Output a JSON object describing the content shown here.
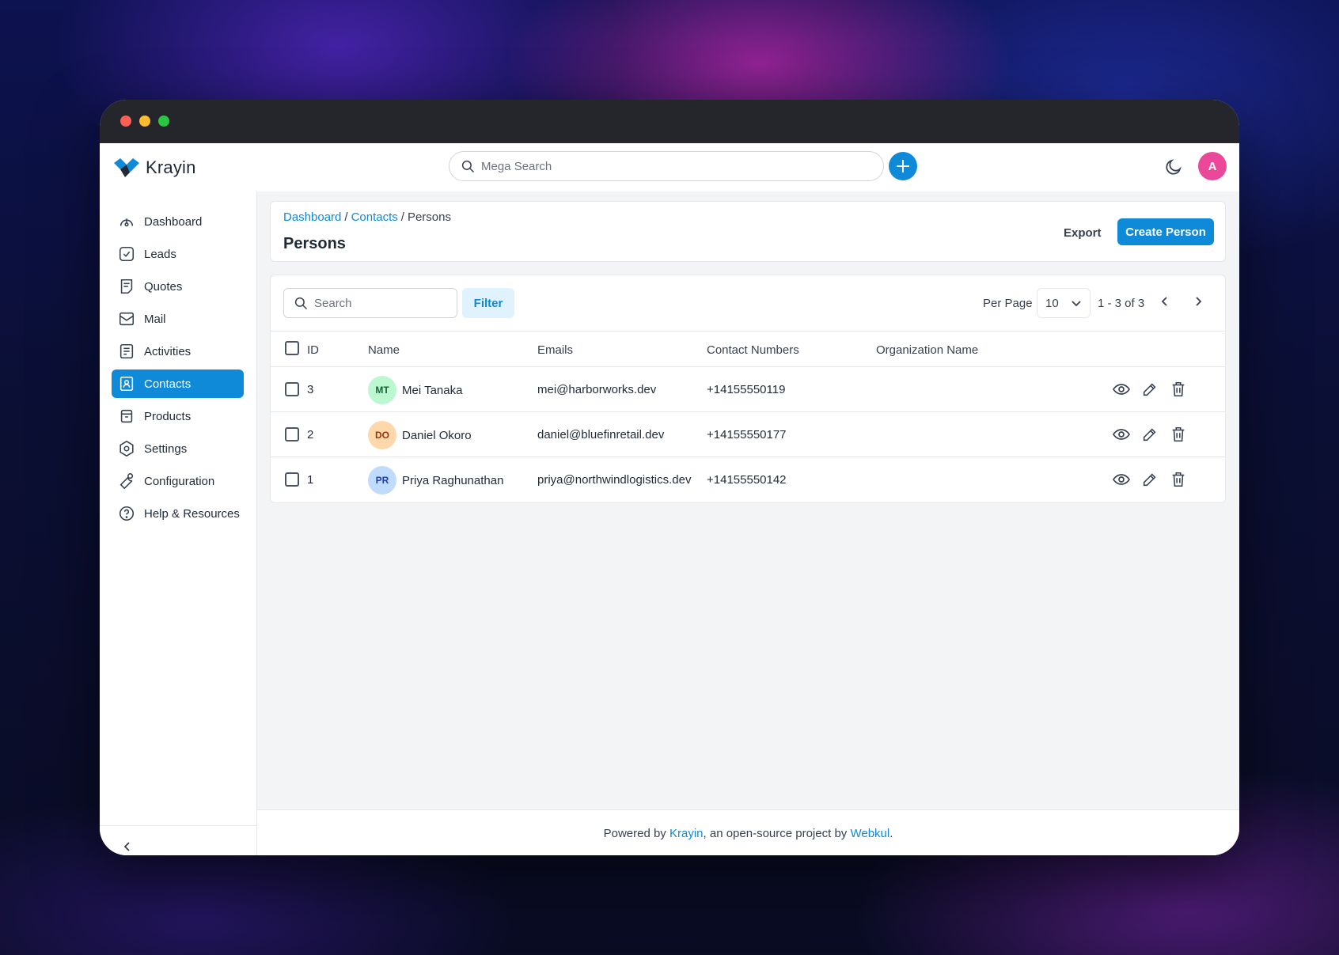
{
  "app": {
    "name": "Krayin"
  },
  "topbar": {
    "search_placeholder": "Mega Search",
    "user_initial": "A"
  },
  "sidebar": {
    "items": [
      {
        "label": "Dashboard",
        "icon": "dashboard-icon"
      },
      {
        "label": "Leads",
        "icon": "leads-icon"
      },
      {
        "label": "Quotes",
        "icon": "quotes-icon"
      },
      {
        "label": "Mail",
        "icon": "mail-icon"
      },
      {
        "label": "Activities",
        "icon": "activities-icon"
      },
      {
        "label": "Contacts",
        "icon": "contacts-icon",
        "active": true
      },
      {
        "label": "Products",
        "icon": "products-icon"
      },
      {
        "label": "Settings",
        "icon": "settings-icon"
      },
      {
        "label": "Configuration",
        "icon": "configuration-icon"
      },
      {
        "label": "Help & Resources",
        "icon": "help-icon"
      }
    ]
  },
  "header": {
    "breadcrumb": [
      "Dashboard",
      "/",
      "Contacts",
      "/",
      "Persons"
    ],
    "title": "Persons",
    "export_label": "Export",
    "create_label": "Create Person"
  },
  "toolbar": {
    "search_placeholder": "Search",
    "filter_label": "Filter",
    "per_page_label": "Per Page",
    "per_page_value": "10",
    "page_info": "1 - 3 of 3"
  },
  "table": {
    "columns": [
      "ID",
      "Name",
      "Emails",
      "Contact Numbers",
      "Organization Name"
    ],
    "rows": [
      {
        "id": "3",
        "initials": "MT",
        "name": "Mei Tanaka",
        "email": "mei@harborworks.dev",
        "phone": "+14155550119",
        "organization": "",
        "avatar_bg": "#bbf7d0",
        "avatar_fg": "#166534"
      },
      {
        "id": "2",
        "initials": "DO",
        "name": "Daniel Okoro",
        "email": "daniel@bluefinretail.dev",
        "phone": "+14155550177",
        "organization": "",
        "avatar_bg": "#fed7aa",
        "avatar_fg": "#9a3412"
      },
      {
        "id": "1",
        "initials": "PR",
        "name": "Priya Raghunathan",
        "email": "priya@northwindlogistics.dev",
        "phone": "+14155550142",
        "organization": "",
        "avatar_bg": "#bfdbfe",
        "avatar_fg": "#1e40af"
      }
    ]
  },
  "footer": {
    "prefix": "Powered by",
    "link1": "Krayin",
    "middle": ", an open-source project by",
    "link2": "Webkul",
    "suffix": "."
  },
  "colors": {
    "accent": "#0e8ad8",
    "avatar": "#ec4899"
  }
}
